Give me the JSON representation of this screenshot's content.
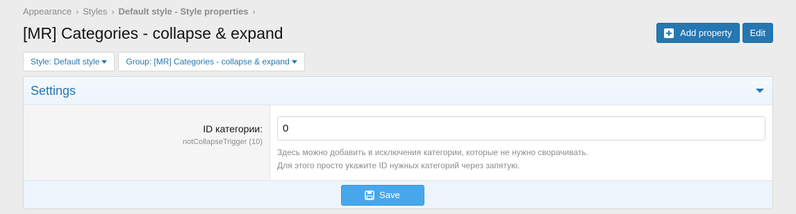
{
  "breadcrumb": {
    "items": [
      "Appearance",
      "Styles",
      "Default style - Style properties"
    ],
    "separator": "›"
  },
  "page": {
    "title": "[MR] Categories - collapse & expand"
  },
  "actions": {
    "add_property": "Add property",
    "edit": "Edit",
    "add_icon": "plus-square-icon"
  },
  "filters": {
    "style": "Style: Default style",
    "group": "Group: [MR] Categories - collapse & expand"
  },
  "settings": {
    "title": "Settings",
    "field": {
      "label": "ID категории:",
      "hint": "notCollapseTrigger (10)",
      "value": "0",
      "explain_line1": "Здесь можно добавить в исключения категории, которые не нужно сворачивать.",
      "explain_line2": "Для этого просто укажите ID нужных категорий через запятую."
    }
  },
  "footer": {
    "save_label": "Save",
    "save_icon": "floppy-disk-icon"
  },
  "colors": {
    "accent": "#2577b1",
    "save": "#47a7eb",
    "background": "#ececec"
  }
}
